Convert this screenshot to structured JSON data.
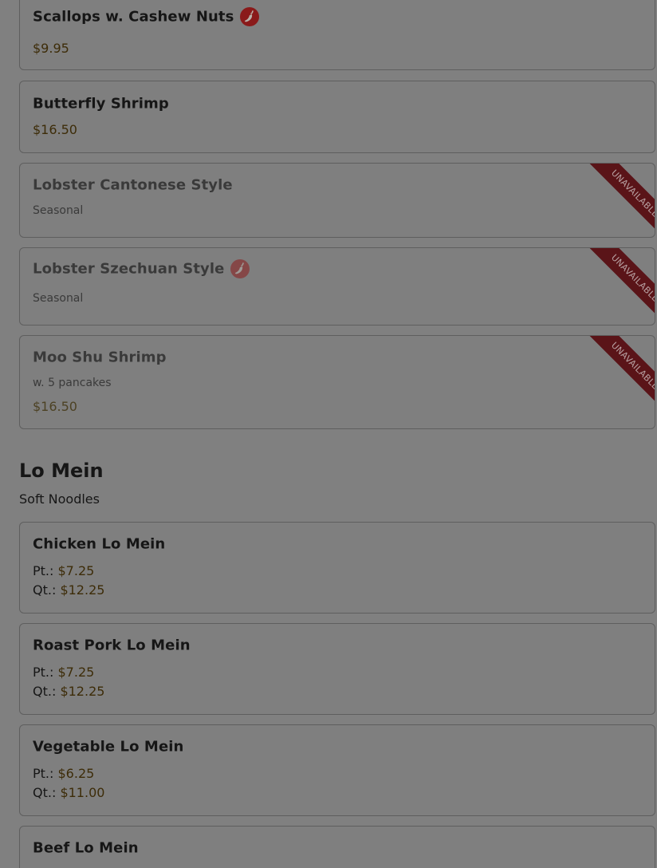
{
  "colors": {
    "overlay": "#808080",
    "ribbon": "#5a1418",
    "spicy_icon": "#8a1a1a",
    "price_text": "#3d2c08"
  },
  "items_top": [
    {
      "name": "Scallops w. Cashew Nuts",
      "spicy": true,
      "price": "$9.95"
    },
    {
      "name": "Butterfly Shrimp",
      "price": "$16.50"
    },
    {
      "name": "Lobster Cantonese Style",
      "description": "Seasonal",
      "status": "UNAVAILABLE"
    },
    {
      "name": "Lobster Szechuan Style",
      "spicy": true,
      "description": "Seasonal",
      "status": "UNAVAILABLE"
    },
    {
      "name": "Moo Shu Shrimp",
      "description": "w. 5 pancakes",
      "price": "$16.50",
      "status": "UNAVAILABLE"
    }
  ],
  "section": {
    "title": "Lo Mein",
    "subtitle": "Soft Noodles"
  },
  "size_labels": {
    "pint": "Pt.:",
    "quart": "Qt.:"
  },
  "lo_mein_items": [
    {
      "name": "Chicken Lo Mein",
      "pt": "$7.25",
      "qt": "$12.25"
    },
    {
      "name": "Roast Pork Lo Mein",
      "pt": "$7.25",
      "qt": "$12.25"
    },
    {
      "name": "Vegetable Lo Mein",
      "pt": "$6.25",
      "qt": "$11.00"
    },
    {
      "name": "Beef Lo Mein"
    }
  ],
  "icons": {
    "spicy": "chili-pepper-icon"
  }
}
